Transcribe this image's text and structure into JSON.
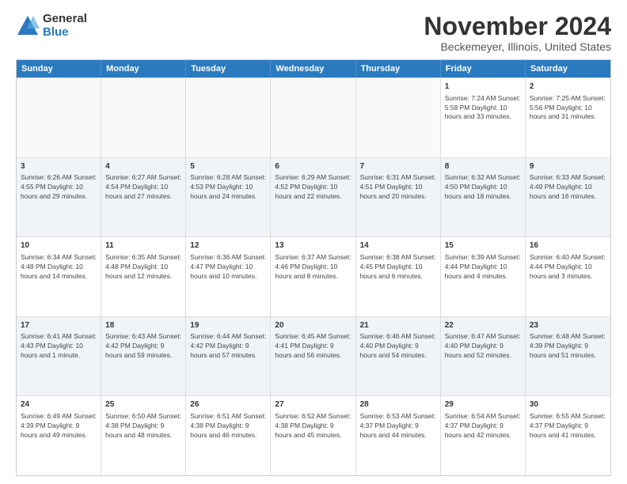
{
  "logo": {
    "general": "General",
    "blue": "Blue"
  },
  "header": {
    "month": "November 2024",
    "location": "Beckemeyer, Illinois, United States"
  },
  "calendar": {
    "days": [
      "Sunday",
      "Monday",
      "Tuesday",
      "Wednesday",
      "Thursday",
      "Friday",
      "Saturday"
    ],
    "rows": [
      [
        {
          "day": "",
          "detail": "",
          "empty": true
        },
        {
          "day": "",
          "detail": "",
          "empty": true
        },
        {
          "day": "",
          "detail": "",
          "empty": true
        },
        {
          "day": "",
          "detail": "",
          "empty": true
        },
        {
          "day": "",
          "detail": "",
          "empty": true
        },
        {
          "day": "1",
          "detail": "Sunrise: 7:24 AM\nSunset: 5:58 PM\nDaylight: 10 hours and 33 minutes."
        },
        {
          "day": "2",
          "detail": "Sunrise: 7:25 AM\nSunset: 5:56 PM\nDaylight: 10 hours and 31 minutes."
        }
      ],
      [
        {
          "day": "3",
          "detail": "Sunrise: 6:26 AM\nSunset: 4:55 PM\nDaylight: 10 hours and 29 minutes."
        },
        {
          "day": "4",
          "detail": "Sunrise: 6:27 AM\nSunset: 4:54 PM\nDaylight: 10 hours and 27 minutes."
        },
        {
          "day": "5",
          "detail": "Sunrise: 6:28 AM\nSunset: 4:53 PM\nDaylight: 10 hours and 24 minutes."
        },
        {
          "day": "6",
          "detail": "Sunrise: 6:29 AM\nSunset: 4:52 PM\nDaylight: 10 hours and 22 minutes."
        },
        {
          "day": "7",
          "detail": "Sunrise: 6:31 AM\nSunset: 4:51 PM\nDaylight: 10 hours and 20 minutes."
        },
        {
          "day": "8",
          "detail": "Sunrise: 6:32 AM\nSunset: 4:50 PM\nDaylight: 10 hours and 18 minutes."
        },
        {
          "day": "9",
          "detail": "Sunrise: 6:33 AM\nSunset: 4:49 PM\nDaylight: 10 hours and 16 minutes."
        }
      ],
      [
        {
          "day": "10",
          "detail": "Sunrise: 6:34 AM\nSunset: 4:48 PM\nDaylight: 10 hours and 14 minutes."
        },
        {
          "day": "11",
          "detail": "Sunrise: 6:35 AM\nSunset: 4:48 PM\nDaylight: 10 hours and 12 minutes."
        },
        {
          "day": "12",
          "detail": "Sunrise: 6:36 AM\nSunset: 4:47 PM\nDaylight: 10 hours and 10 minutes."
        },
        {
          "day": "13",
          "detail": "Sunrise: 6:37 AM\nSunset: 4:46 PM\nDaylight: 10 hours and 8 minutes."
        },
        {
          "day": "14",
          "detail": "Sunrise: 6:38 AM\nSunset: 4:45 PM\nDaylight: 10 hours and 6 minutes."
        },
        {
          "day": "15",
          "detail": "Sunrise: 6:39 AM\nSunset: 4:44 PM\nDaylight: 10 hours and 4 minutes."
        },
        {
          "day": "16",
          "detail": "Sunrise: 6:40 AM\nSunset: 4:44 PM\nDaylight: 10 hours and 3 minutes."
        }
      ],
      [
        {
          "day": "17",
          "detail": "Sunrise: 6:41 AM\nSunset: 4:43 PM\nDaylight: 10 hours and 1 minute."
        },
        {
          "day": "18",
          "detail": "Sunrise: 6:43 AM\nSunset: 4:42 PM\nDaylight: 9 hours and 59 minutes."
        },
        {
          "day": "19",
          "detail": "Sunrise: 6:44 AM\nSunset: 4:42 PM\nDaylight: 9 hours and 57 minutes."
        },
        {
          "day": "20",
          "detail": "Sunrise: 6:45 AM\nSunset: 4:41 PM\nDaylight: 9 hours and 56 minutes."
        },
        {
          "day": "21",
          "detail": "Sunrise: 6:46 AM\nSunset: 4:40 PM\nDaylight: 9 hours and 54 minutes."
        },
        {
          "day": "22",
          "detail": "Sunrise: 6:47 AM\nSunset: 4:40 PM\nDaylight: 9 hours and 52 minutes."
        },
        {
          "day": "23",
          "detail": "Sunrise: 6:48 AM\nSunset: 4:39 PM\nDaylight: 9 hours and 51 minutes."
        }
      ],
      [
        {
          "day": "24",
          "detail": "Sunrise: 6:49 AM\nSunset: 4:39 PM\nDaylight: 9 hours and 49 minutes."
        },
        {
          "day": "25",
          "detail": "Sunrise: 6:50 AM\nSunset: 4:38 PM\nDaylight: 9 hours and 48 minutes."
        },
        {
          "day": "26",
          "detail": "Sunrise: 6:51 AM\nSunset: 4:38 PM\nDaylight: 9 hours and 46 minutes."
        },
        {
          "day": "27",
          "detail": "Sunrise: 6:52 AM\nSunset: 4:38 PM\nDaylight: 9 hours and 45 minutes."
        },
        {
          "day": "28",
          "detail": "Sunrise: 6:53 AM\nSunset: 4:37 PM\nDaylight: 9 hours and 44 minutes."
        },
        {
          "day": "29",
          "detail": "Sunrise: 6:54 AM\nSunset: 4:37 PM\nDaylight: 9 hours and 42 minutes."
        },
        {
          "day": "30",
          "detail": "Sunrise: 6:55 AM\nSunset: 4:37 PM\nDaylight: 9 hours and 41 minutes."
        }
      ]
    ]
  }
}
